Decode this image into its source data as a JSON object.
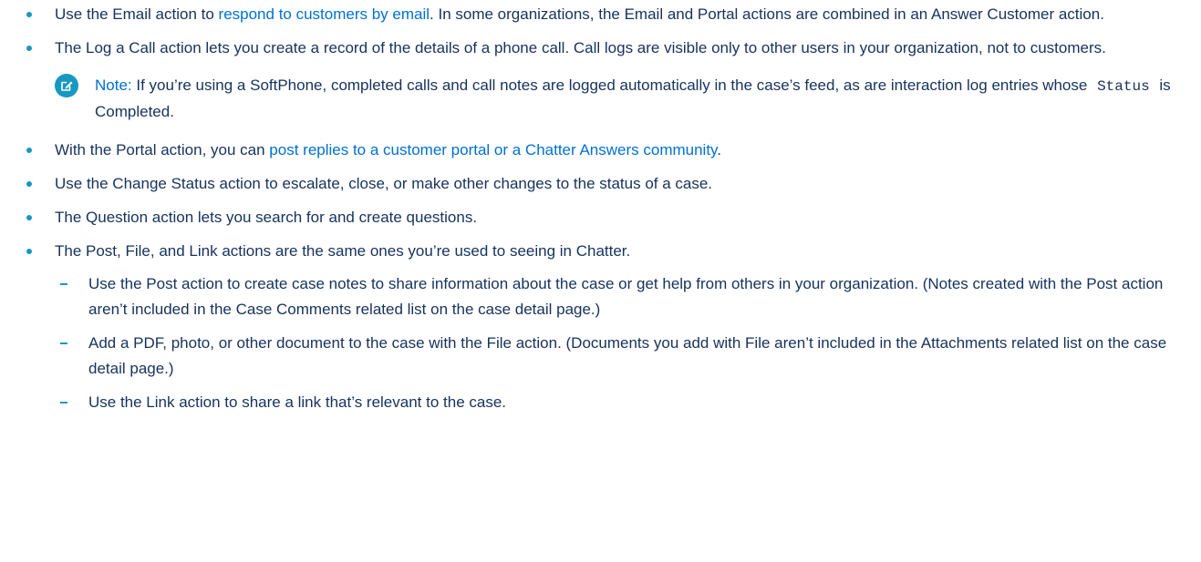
{
  "items": [
    {
      "before": "Use the Email action to ",
      "link": "respond to customers by email",
      "after": ". In some organizations, the Email and Portal actions are combined in an Answer Customer action."
    },
    {
      "text": "The Log a Call action lets you create a record of the details of a phone call. Call logs are visible only to other users in your organization, not to customers."
    },
    {
      "before": "With the Portal action, you can ",
      "link": "post replies to a customer portal or a Chatter Answers community",
      "after": "."
    },
    {
      "text": "Use the Change Status action to escalate, close, or make other changes to the status of a case."
    },
    {
      "text": "The Question action lets you search for and create questions."
    },
    {
      "text": "The Post, File, and Link actions are the same ones you’re used to seeing in Chatter."
    }
  ],
  "note": {
    "label": "Note:",
    "text_before": " If you’re using a SoftPhone, completed calls and call notes are logged automatically in the case’s feed, as are interaction log entries whose ",
    "code": "Status",
    "text_after": " is Completed.",
    "icon": "edit-note-icon"
  },
  "subitems": [
    "Use the Post action to create case notes to share information about the case or get help from others in your organization. (Notes created with the Post action aren’t included in the Case Comments related list on the case detail page.)",
    "Add a PDF, photo, or other document to the case with the File action. (Documents you add with File aren’t included in the Attachments related list on the case detail page.)",
    "Use the Link action to share a link that’s relevant to the case."
  ],
  "colors": {
    "text": "#16325c",
    "link": "#0070d2",
    "bullet": "#1798c1",
    "note_icon": "#1798c1"
  }
}
